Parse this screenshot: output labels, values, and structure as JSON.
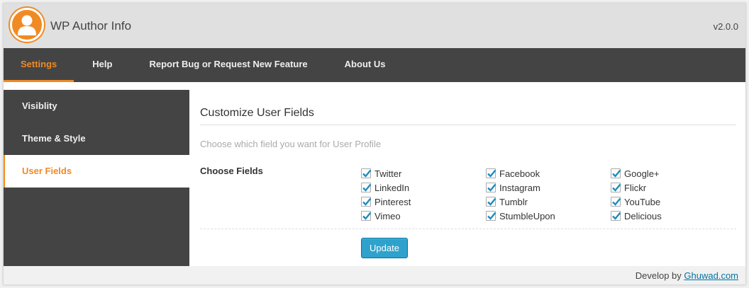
{
  "header": {
    "title": "WP Author Info",
    "version": "v2.0.0",
    "logo_icon": "user-avatar-icon"
  },
  "nav": {
    "items": [
      {
        "label": "Settings",
        "active": true
      },
      {
        "label": "Help"
      },
      {
        "label": "Report Bug or Request New Feature"
      },
      {
        "label": "About Us"
      }
    ]
  },
  "sidebar": {
    "items": [
      {
        "label": "Visiblity"
      },
      {
        "label": "Theme & Style"
      },
      {
        "label": "User Fields",
        "active": true
      }
    ]
  },
  "main": {
    "title": "Customize User Fields",
    "description": "Choose which field you want for User Profile",
    "fields_label": "Choose Fields",
    "fields": [
      {
        "label": "Twitter",
        "checked": true
      },
      {
        "label": "Facebook",
        "checked": true
      },
      {
        "label": "Google+",
        "checked": true
      },
      {
        "label": "LinkedIn",
        "checked": true
      },
      {
        "label": "Instagram",
        "checked": true
      },
      {
        "label": "Flickr",
        "checked": true
      },
      {
        "label": "Pinterest",
        "checked": true
      },
      {
        "label": "Tumblr",
        "checked": true
      },
      {
        "label": "YouTube",
        "checked": true
      },
      {
        "label": "Vimeo",
        "checked": true
      },
      {
        "label": "StumbleUpon",
        "checked": true
      },
      {
        "label": "Delicious",
        "checked": true
      }
    ],
    "update_label": "Update"
  },
  "footer": {
    "prefix": "Develop by",
    "link_text": "Ghuwad.com"
  },
  "colors": {
    "accent": "#f08a24",
    "dark": "#444444",
    "button": "#2ea2cc",
    "check": "#1e8cbe"
  }
}
